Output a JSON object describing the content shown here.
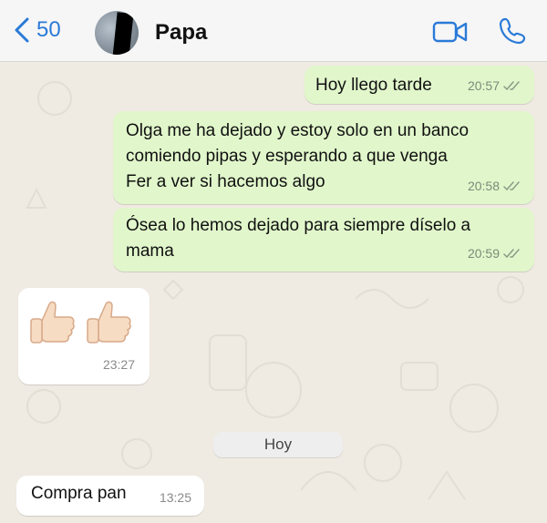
{
  "header": {
    "back_count": "50",
    "contact_name": "Papa"
  },
  "day_separator": "Hoy",
  "messages": [
    {
      "direction": "outgoing",
      "text": "Hoy llego tarde",
      "time": "20:57",
      "status": "read"
    },
    {
      "direction": "outgoing",
      "text": "Olga me ha dejado y estoy solo en un banco\ncomiendo pipas y esperando a que venga\nFer a ver si hacemos algo",
      "time": "20:58",
      "status": "read"
    },
    {
      "direction": "outgoing",
      "text": "Ósea lo hemos dejado para siempre díselo a\nmama",
      "time": "20:59",
      "status": "read"
    },
    {
      "direction": "incoming",
      "text": "👍👍",
      "time": "23:27"
    },
    {
      "direction": "incoming",
      "text": "Compra pan",
      "time": "13:25"
    }
  ],
  "colors": {
    "accent": "#2a7ad8",
    "outgoing_bubble": "#e1f7cb",
    "incoming_bubble": "#ffffff",
    "chat_background": "#efeae2"
  },
  "icons": [
    "chevron-left-icon",
    "video-call-icon",
    "phone-icon",
    "double-check-icon",
    "thumbs-up-icon"
  ]
}
